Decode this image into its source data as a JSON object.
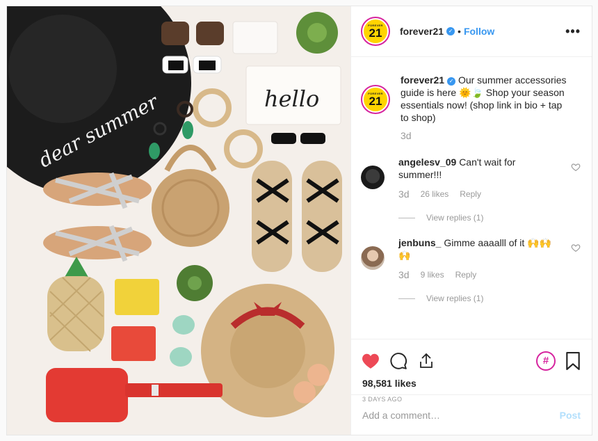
{
  "post": {
    "username": "forever21",
    "follow_label": "Follow",
    "dot": "•",
    "more_label": "•••",
    "avatar_top": "FOREVER",
    "avatar_num": "21"
  },
  "caption": {
    "username": "forever21",
    "text": "Our summer accessories guide is here 🌞🍃 Shop your season essentials now! (shop link in bio + tap to shop)",
    "time": "3d"
  },
  "comments": [
    {
      "username": "angelesv_09",
      "text": "Can't wait for summer!!!",
      "time": "3d",
      "likes": "26 likes",
      "reply": "Reply",
      "view_replies": "View replies (1)"
    },
    {
      "username": "jenbuns_",
      "text": "Gimme aaaalll of it 🙌🙌🙌",
      "time": "3d",
      "likes": "9 likes",
      "reply": "Reply",
      "view_replies": "View replies (1)"
    }
  ],
  "footer": {
    "likes": "98,581 likes",
    "date": "3 DAYS AGO",
    "add_comment_placeholder": "Add a comment…",
    "post_label": "Post",
    "hashtag": "#"
  },
  "photo": {
    "hat_text": "dear summer",
    "pouch_text": "hello"
  },
  "colors": {
    "accent_blue": "#3897f0",
    "like_red": "#ed4956",
    "brand_yellow": "#ffd400",
    "brand_magenta": "#d6249f"
  },
  "icons": [
    "verified-badge-icon",
    "heart-filled-icon",
    "comment-icon",
    "share-icon",
    "hashtag-icon",
    "bookmark-icon",
    "heart-outline-icon",
    "more-options-icon"
  ]
}
